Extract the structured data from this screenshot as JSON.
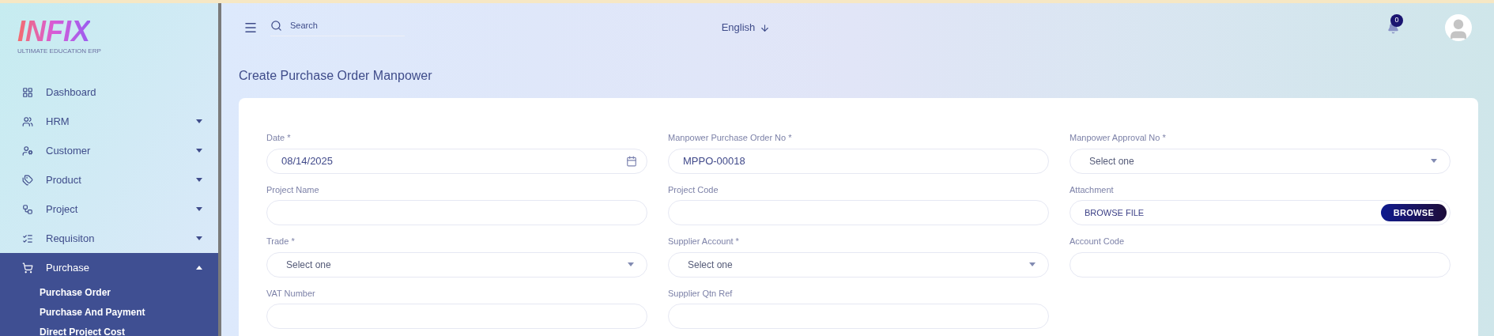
{
  "logo": {
    "name": "INFIX",
    "tagline": "ULTIMATE EDUCATION ERP"
  },
  "sidebar": {
    "items": [
      {
        "label": "Dashboard",
        "selected": false
      },
      {
        "label": "HRM",
        "selected": false,
        "expanded": false
      },
      {
        "label": "Customer",
        "selected": false,
        "expanded": false
      },
      {
        "label": "Product",
        "selected": false,
        "expanded": false
      },
      {
        "label": "Project",
        "selected": false,
        "expanded": false
      },
      {
        "label": "Requisiton",
        "selected": false,
        "expanded": false
      },
      {
        "label": "Purchase",
        "selected": true,
        "expanded": true,
        "children": [
          {
            "label": "Purchase Order"
          },
          {
            "label": "Purchase And Payment"
          },
          {
            "label": "Direct Project Cost"
          }
        ]
      }
    ]
  },
  "topbar": {
    "search": {
      "placeholder": "Search"
    },
    "language": "English",
    "notifications": "0"
  },
  "page_title": "Create Purchase Order Manpower",
  "form": {
    "fields": [
      {
        "label": "Date *",
        "kind": "date",
        "value": "08/14/2025"
      },
      {
        "label": "Manpower Purchase Order No *",
        "kind": "text",
        "value": "MPPO-00018"
      },
      {
        "label": "Manpower Approval No *",
        "kind": "select",
        "value": "Select one"
      },
      {
        "label": "Project Name",
        "kind": "text"
      },
      {
        "label": "Project Code",
        "kind": "text"
      },
      {
        "label": "Attachment",
        "kind": "file",
        "placeholder": "BROWSE FILE",
        "button": "BROWSE"
      },
      {
        "label": "Trade *",
        "kind": "select",
        "value": "Select one"
      },
      {
        "label": "Supplier Account *",
        "kind": "select",
        "value": "Select one"
      },
      {
        "label": "Account Code",
        "kind": "text"
      },
      {
        "label": "VAT Number",
        "kind": "text"
      },
      {
        "label": "Supplier Qtn Ref",
        "kind": "text"
      }
    ]
  }
}
